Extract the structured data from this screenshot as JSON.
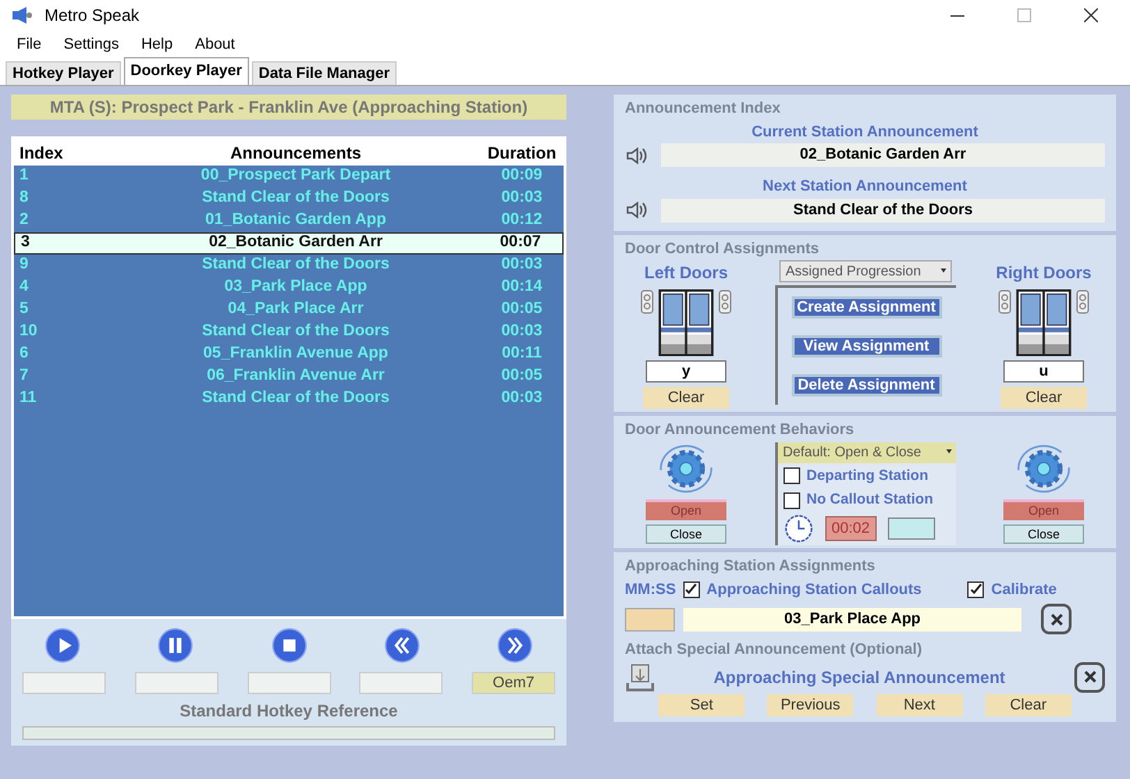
{
  "window": {
    "title": "Metro Speak"
  },
  "menu": [
    "File",
    "Settings",
    "Help",
    "About"
  ],
  "tabs": [
    {
      "label": "Hotkey Player",
      "selected": false
    },
    {
      "label": "Doorkey Player",
      "selected": true
    },
    {
      "label": "Data File Manager",
      "selected": false
    }
  ],
  "route_banner": "MTA (S): Prospect Park - Franklin Ave (Approaching Station)",
  "table": {
    "columns": [
      "Index",
      "Announcements",
      "Duration"
    ],
    "rows": [
      {
        "index": "1",
        "announcement": "00_Prospect Park Depart",
        "duration": "00:09",
        "selected": false
      },
      {
        "index": "8",
        "announcement": "Stand Clear of the Doors",
        "duration": "00:03",
        "selected": false
      },
      {
        "index": "2",
        "announcement": "01_Botanic Garden App",
        "duration": "00:12",
        "selected": false
      },
      {
        "index": "3",
        "announcement": "02_Botanic Garden Arr",
        "duration": "00:07",
        "selected": true
      },
      {
        "index": "9",
        "announcement": "Stand Clear of the Doors",
        "duration": "00:03",
        "selected": false
      },
      {
        "index": "4",
        "announcement": "03_Park Place App",
        "duration": "00:14",
        "selected": false
      },
      {
        "index": "5",
        "announcement": "04_Park Place Arr",
        "duration": "00:05",
        "selected": false
      },
      {
        "index": "10",
        "announcement": "Stand Clear of the Doors",
        "duration": "00:03",
        "selected": false
      },
      {
        "index": "6",
        "announcement": "05_Franklin Avenue App",
        "duration": "00:11",
        "selected": false
      },
      {
        "index": "7",
        "announcement": "06_Franklin Avenue Arr",
        "duration": "00:05",
        "selected": false
      },
      {
        "index": "11",
        "announcement": "Stand Clear of the Doors",
        "duration": "00:03",
        "selected": false
      }
    ]
  },
  "player": {
    "buttons": [
      {
        "kind": "play"
      },
      {
        "kind": "pause"
      },
      {
        "kind": "stop"
      },
      {
        "kind": "rewind"
      },
      {
        "kind": "forward"
      }
    ],
    "hotkeys": [
      {
        "highlighted": false
      },
      {
        "highlighted": false
      },
      {
        "highlighted": false
      },
      {
        "highlighted": false
      },
      {
        "highlighted": true,
        "value": "Oem7"
      }
    ],
    "reference_label": "Standard Hotkey Reference"
  },
  "announcement_index": {
    "title": "Announcement Index",
    "current_label": "Current Station Announcement",
    "current_value": "02_Botanic Garden Arr",
    "next_label": "Next Station Announcement",
    "next_value": "Stand Clear of the Doors"
  },
  "door_control": {
    "title": "Door Control Assignments",
    "left_label": "Left Doors",
    "right_label": "Right Doors",
    "mode": "Assigned Progression",
    "left_key": "y",
    "right_key": "u",
    "clear_left": "Clear",
    "clear_right": "Clear",
    "actions": [
      "Create Assignment",
      "View Assignment",
      "Delete Assignment"
    ]
  },
  "door_behaviors": {
    "title": "Door Announcement Behaviors",
    "mode": "Default: Open & Close",
    "options": [
      {
        "label": "Departing Station",
        "checked": false
      },
      {
        "label": "No Callout Station",
        "checked": false
      }
    ],
    "time": "00:02",
    "left_open": "Open",
    "left_close": "Close",
    "right_open": "Open",
    "right_close": "Close"
  },
  "approaching": {
    "title": "Approaching Station Assignments",
    "time_label": "MM:SS",
    "options": [
      {
        "label": "Approaching Station Callouts",
        "checked": true
      },
      {
        "label": "Calibrate",
        "checked": true
      }
    ],
    "value": "03_Park Place App"
  },
  "special": {
    "title": "Attach Special Announcement (Optional)",
    "label": "Approaching Special Announcement",
    "buttons": [
      "Set",
      "Previous",
      "Next",
      "Clear"
    ]
  }
}
